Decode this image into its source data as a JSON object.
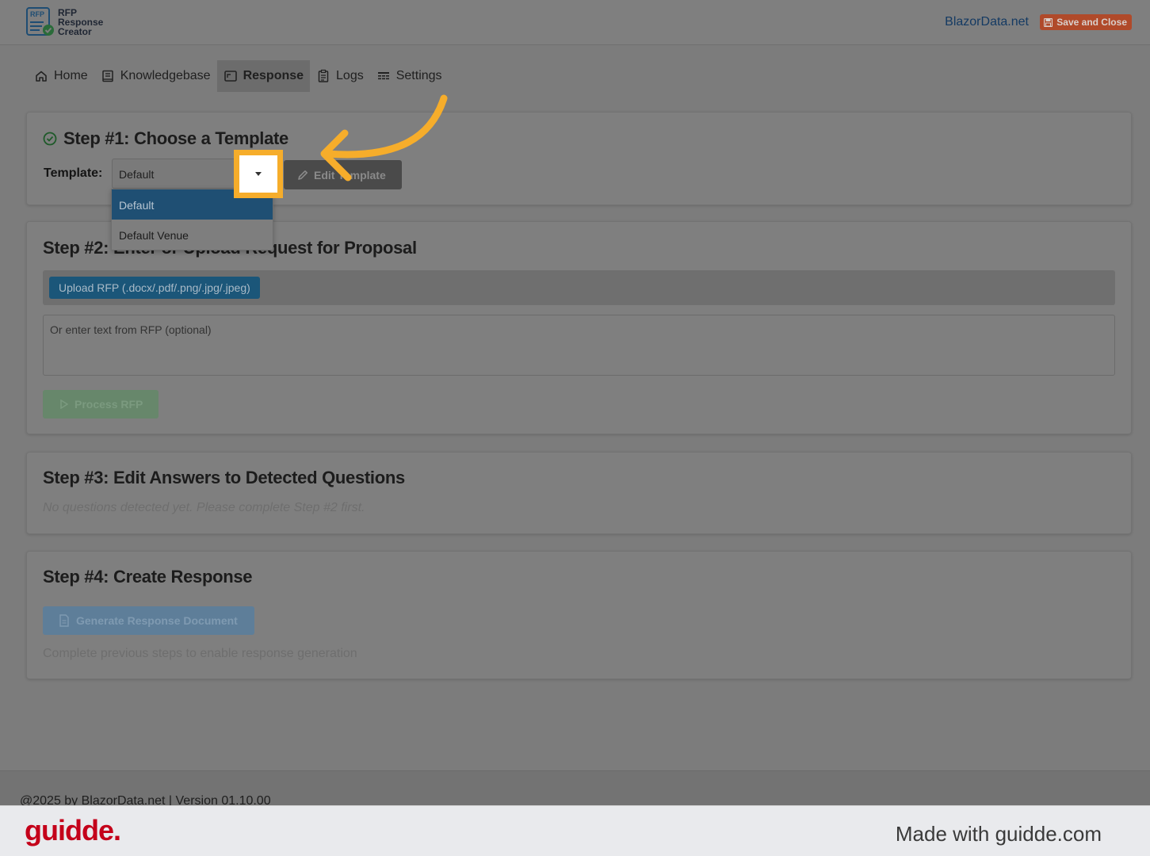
{
  "header": {
    "logo_badge": "RFP",
    "logo_lines": [
      "RFP",
      "Response",
      "Creator"
    ],
    "brand_link": "BlazorData.net",
    "save_close_label": "Save and Close"
  },
  "nav": {
    "items": [
      {
        "label": "Home",
        "icon": "home-icon"
      },
      {
        "label": "Knowledgebase",
        "icon": "book-icon"
      },
      {
        "label": "Response",
        "icon": "reply-window-icon",
        "active": true
      },
      {
        "label": "Logs",
        "icon": "clipboard-icon"
      },
      {
        "label": "Settings",
        "icon": "settings-list-icon"
      }
    ]
  },
  "step1": {
    "title": "Step #1: Choose a Template",
    "template_label": "Template:",
    "selected_value": "Default",
    "edit_label": "Edit Template",
    "options": [
      "Default",
      "Default Venue"
    ]
  },
  "step2": {
    "title": "Step #2: Enter or Upload Request for Proposal",
    "upload_label": "Upload RFP (.docx/.pdf/.png/.jpg/.jpeg)",
    "text_placeholder": "Or enter text from RFP (optional)",
    "process_label": "Process RFP"
  },
  "step3": {
    "title": "Step #3: Edit Answers to Detected Questions",
    "empty_message": "No questions detected yet. Please complete Step #2 first."
  },
  "step4": {
    "title": "Step #4: Create Response",
    "generate_label": "Generate Response Document",
    "hint": "Complete previous steps to enable response generation"
  },
  "footer": {
    "text": "@2025 by BlazorData.net | Version 01.10.00"
  },
  "guidde": {
    "logo": "guidde.",
    "made_with": "Made with guidde.com"
  },
  "colors": {
    "highlight": "#f6ad2b",
    "guidde_red": "#c4001a"
  }
}
